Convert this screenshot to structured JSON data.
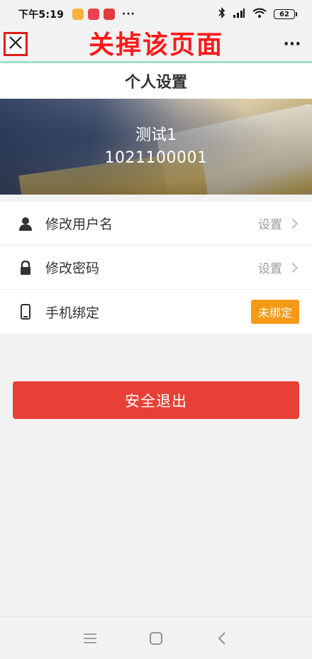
{
  "status_bar": {
    "time": "下午5:19",
    "more": "···",
    "battery": "62"
  },
  "title_bar": {
    "annotation": "关掉该页面",
    "more": "···"
  },
  "page": {
    "title": "个人设置"
  },
  "profile": {
    "name": "测试1",
    "user_id": "1021100001"
  },
  "settings": {
    "items": [
      {
        "label": "修改用户名",
        "action": "设置",
        "icon": "user-icon"
      },
      {
        "label": "修改密码",
        "action": "设置",
        "icon": "lock-icon"
      },
      {
        "label": "手机绑定",
        "badge": "未绑定",
        "icon": "phone-icon"
      }
    ]
  },
  "logout": {
    "label": "安全退出"
  },
  "colors": {
    "accent_line": "#9fe0c3",
    "logout_bg": "#e84037",
    "badge_bg": "#f59a17",
    "annotation": "#ff1a1a"
  }
}
